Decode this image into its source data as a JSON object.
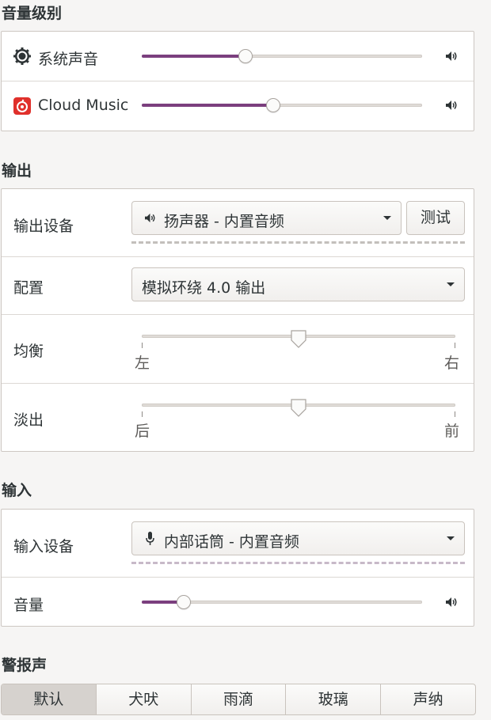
{
  "volume_levels": {
    "title": "音量级别",
    "apps": [
      {
        "name": "系统声音",
        "icon": "gear-icon",
        "level": 0.37
      },
      {
        "name": "Cloud Music",
        "icon": "cloud-music-icon",
        "level": 0.47
      }
    ]
  },
  "output": {
    "title": "输出",
    "device_label": "输出设备",
    "device_value": "扬声器 - 内置音频",
    "device_icon": "speaker-icon",
    "test_button": "测试",
    "profile_label": "配置",
    "profile_value": "模拟环绕 4.0 输出",
    "balance_label": "均衡",
    "balance_left": "左",
    "balance_right": "右",
    "balance_value": 0.5,
    "fade_label": "淡出",
    "fade_rear": "后",
    "fade_front": "前",
    "fade_value": 0.5
  },
  "input": {
    "title": "输入",
    "device_label": "输入设备",
    "device_value": "内部话筒 - 内置音频",
    "device_icon": "microphone-icon",
    "volume_label": "音量",
    "volume_level": 0.15
  },
  "alert": {
    "title": "警报声",
    "options": [
      "默认",
      "犬吠",
      "雨滴",
      "玻璃",
      "声纳"
    ],
    "selected": 0
  },
  "colors": {
    "accent": "#7b3f7e",
    "cloud_music_red": "#e0302b"
  }
}
